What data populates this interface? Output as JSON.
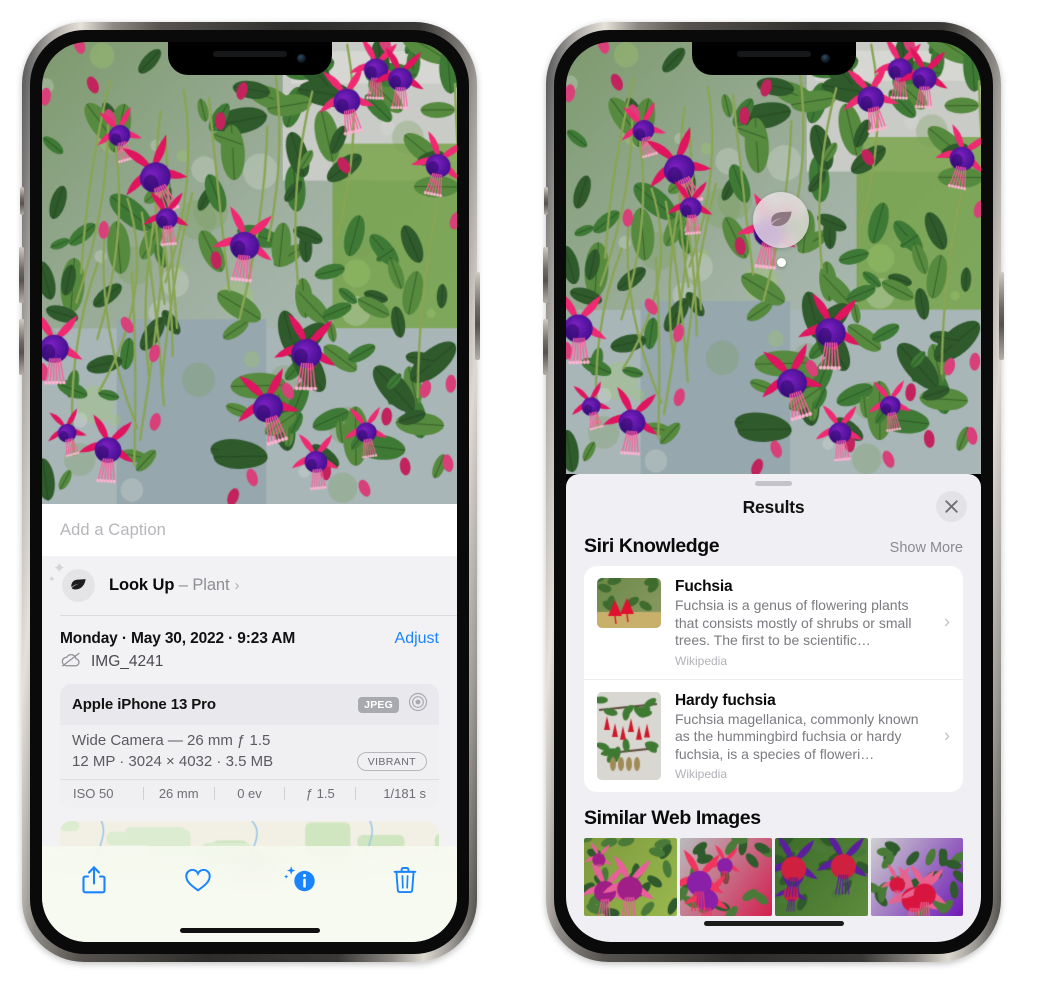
{
  "left_phone": {
    "caption": {
      "placeholder": "Add a Caption",
      "value": ""
    },
    "look_up": {
      "icon": "leaf-icon",
      "label": "Look Up",
      "dash": "–",
      "subject": "Plant",
      "chevron": "›"
    },
    "date_row": {
      "date": "Monday · May 30, 2022 · 9:23 AM",
      "adjust_label": "Adjust"
    },
    "file_row": {
      "icon": "cloud-slash-icon",
      "filename": "IMG_4241"
    },
    "metadata": {
      "device": "Apple iPhone 13 Pro",
      "format_badge": "JPEG",
      "aperture_icon": "camera-target-icon",
      "lens_line": "Wide Camera — 26 mm ƒ 1.5",
      "size_line": "12 MP · 3024 × 4032 · 3.5 MB",
      "style_badge": "VIBRANT",
      "exif": [
        "ISO 50",
        "26 mm",
        "0 ev",
        "ƒ 1.5",
        "1/181 s"
      ]
    },
    "toolbar": [
      {
        "name": "share-button",
        "icon": "share-icon"
      },
      {
        "name": "favorite-button",
        "icon": "heart-icon"
      },
      {
        "name": "info-button",
        "icon": "info-sparkle-icon"
      },
      {
        "name": "delete-button",
        "icon": "trash-icon"
      }
    ]
  },
  "right_phone": {
    "visual_look_up_badge": {
      "icon": "leaf-icon"
    },
    "sheet": {
      "title": "Results",
      "close_icon": "close-icon"
    },
    "siri_knowledge": {
      "heading": "Siri Knowledge",
      "show_more": "Show More",
      "items": [
        {
          "title": "Fuchsia",
          "description": "Fuchsia is a genus of flowering plants that consists mostly of shrubs or small trees. The first to be scientific…",
          "source": "Wikipedia",
          "chevron": "›"
        },
        {
          "title": "Hardy fuchsia",
          "description": "Fuchsia magellanica, commonly known as the hummingbird fuchsia or hardy fuchsia, is a species of floweri…",
          "source": "Wikipedia",
          "chevron": "›"
        }
      ]
    },
    "similar_web_images": {
      "heading": "Similar Web Images",
      "count": 4
    }
  },
  "colors": {
    "accent_blue": "#1a84ff",
    "sheet_bg": "#f0f0f4",
    "card_bg": "#ffffff",
    "secondary_text": "#8e8e93"
  }
}
